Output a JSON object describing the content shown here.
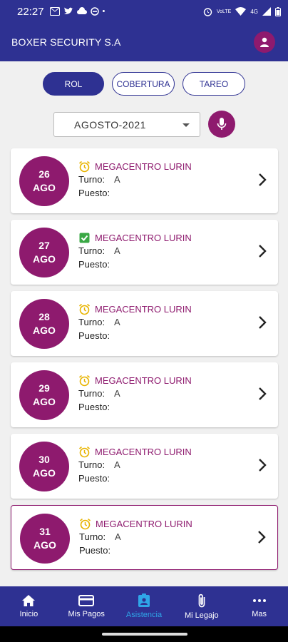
{
  "status": {
    "time": "22:27",
    "network": "VoLTE",
    "signal_text": "4G"
  },
  "app": {
    "title": "BOXER SECURITY S.A"
  },
  "tabs": [
    {
      "label": "ROL",
      "active": true
    },
    {
      "label": "COBERTURA",
      "active": false
    },
    {
      "label": "TAREO",
      "active": false
    }
  ],
  "month_select": {
    "value": "AGOSTO-2021"
  },
  "labels": {
    "turno": "Turno:",
    "puesto": "Puesto:"
  },
  "cards": [
    {
      "day": "26",
      "month": "AGO",
      "status_icon": "alarm-clock-icon",
      "location": "MEGACENTRO LURIN",
      "turno": "A",
      "puesto": ""
    },
    {
      "day": "27",
      "month": "AGO",
      "status_icon": "check-box-icon",
      "location": "MEGACENTRO LURIN",
      "turno": "A",
      "puesto": ""
    },
    {
      "day": "28",
      "month": "AGO",
      "status_icon": "alarm-clock-icon",
      "location": "MEGACENTRO LURIN",
      "turno": "A",
      "puesto": ""
    },
    {
      "day": "29",
      "month": "AGO",
      "status_icon": "alarm-clock-icon",
      "location": "MEGACENTRO LURIN",
      "turno": "A",
      "puesto": ""
    },
    {
      "day": "30",
      "month": "AGO",
      "status_icon": "alarm-clock-icon",
      "location": "MEGACENTRO LURIN",
      "turno": "A",
      "puesto": ""
    },
    {
      "day": "31",
      "month": "AGO",
      "status_icon": "alarm-clock-icon",
      "location": "MEGACENTRO LURIN",
      "turno": "A",
      "puesto": ""
    }
  ],
  "nav": [
    {
      "label": "Inicio",
      "icon": "home-icon",
      "active": false
    },
    {
      "label": "Mis Pagos",
      "icon": "credit-card-icon",
      "active": false
    },
    {
      "label": "Asistencia",
      "icon": "contact-card-icon",
      "active": true
    },
    {
      "label": "Mi Legajo",
      "icon": "paperclip-icon",
      "active": false
    },
    {
      "label": "Mas",
      "icon": "more-horizontal-icon",
      "active": false
    }
  ],
  "colors": {
    "primary": "#2e3192",
    "accent": "#8e1a6e",
    "active_nav": "#2fa6e8",
    "alarm": "#e8b400",
    "check": "#3aa845"
  }
}
